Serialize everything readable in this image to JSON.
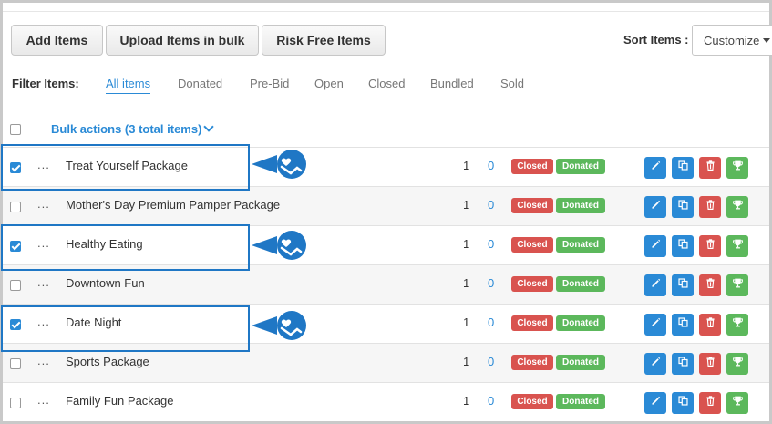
{
  "toolbar": {
    "add_items": "Add Items",
    "upload_bulk": "Upload Items in bulk",
    "risk_free": "Risk Free Items",
    "sort_label": "Sort Items :",
    "sort_value": "Customize"
  },
  "filters": {
    "label": "Filter Items:",
    "items": [
      "All items",
      "Donated",
      "Pre-Bid",
      "Open",
      "Closed",
      "Bundled",
      "Sold"
    ],
    "active": "All items"
  },
  "bulk": {
    "label": "Bulk actions (3 total items)"
  },
  "rows": [
    {
      "dots": "...",
      "name": "Treat Yourself Package",
      "qty": "1",
      "bids": "0",
      "status": "Closed",
      "donated": "Donated",
      "checked": true
    },
    {
      "dots": "...",
      "name": "Mother's Day Premium Pamper Package",
      "qty": "1",
      "bids": "0",
      "status": "Closed",
      "donated": "Donated",
      "checked": false
    },
    {
      "dots": "...",
      "name": "Healthy Eating",
      "qty": "1",
      "bids": "0",
      "status": "Closed",
      "donated": "Donated",
      "checked": true
    },
    {
      "dots": "...",
      "name": "Downtown Fun",
      "qty": "1",
      "bids": "0",
      "status": "Closed",
      "donated": "Donated",
      "checked": false
    },
    {
      "dots": "...",
      "name": "Date Night",
      "qty": "1",
      "bids": "0",
      "status": "Closed",
      "donated": "Donated",
      "checked": true
    },
    {
      "dots": "...",
      "name": "Sports Package",
      "qty": "1",
      "bids": "0",
      "status": "Closed",
      "donated": "Donated",
      "checked": false
    },
    {
      "dots": "...",
      "name": "Family Fun Package",
      "qty": "1",
      "bids": "0",
      "status": "Closed",
      "donated": "Donated",
      "checked": false
    }
  ],
  "icons": {
    "edit": "pencil-icon",
    "copy": "copy-icon",
    "delete": "trash-icon",
    "award": "trophy-icon",
    "callout": "hand-heart-icon"
  },
  "colors": {
    "accent": "#2a8ad6",
    "closed": "#d9534f",
    "donated": "#5cb85c",
    "highlight": "#1f77c5"
  }
}
